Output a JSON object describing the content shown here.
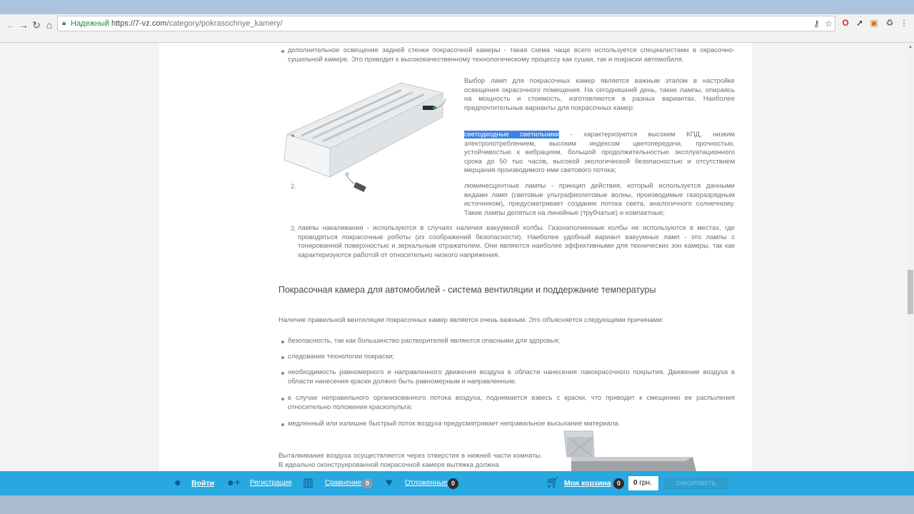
{
  "browser": {
    "security_label": "Надежный",
    "url_host": "https://7-vz.com",
    "url_path": "/category/pokrasochnye_kamery/"
  },
  "article": {
    "bullet_top": "дополнительное освещение задней стенки покрасочной камеры - такая схема чаще всего используется специалистами в окрасочно-сушильной камере. Это приводит к высококачественному технологическому процессу как сушки, так и покраски автомобиля.",
    "lamp_intro": " Выбор ламп для покрасочных камер является важным этапом в настройке освещения окрасочного помещения. На сегодняшний день, такие лампы, опираясь на мощность и стоимость, изготовляются в разных вариантах.  Наиболее предпочтительные варианты для покрасочных камер:",
    "item1_highlight": "светодиодные светильники",
    "item1_rest": " - характеризуются высоким КПД, низким электропотреблением, высоким индексом цветопередачи, прочностью, устойчивостью к вибрациям, большой продолжительностью эксплуатационного срока до 50 тыс  часов, высокой экологической безопасностью и отсутствием мерцания производимого ими светового потока;",
    "item2_num": "2.",
    "item2": "люминесцентные лампы - принцип действия, который используется данными видами ламп (световые ультрафиолетовые волны, производимые газоразрядным источником), предусматривает создание потока света, аналогичного солнечному. Такие лампы деляться на линейные (трубчатые) и компактные;",
    "item3_num": "3.",
    "item3": "лампы накаливания - используются в случаях наличия вакуумной колбы. Газонаполненные колбы не используются в местах, где проводяться покрасочные роботы  (из соображений безопасности). Наиболее удобный вариант вакуумных ламп - это лампы с тонированной поверхностью и зеркальным отражателем. Они являются наиболее эффективными для технических зон камеры, так как характеризуются работой от относительно низкого напряжения.",
    "heading": "Покрасочная камера для автомобилей - система вентиляции и поддержание температуры",
    "ventilation_intro": "Наличие правильной вентиляции покрасочных камер является очень важным. Это объясняется следующими причинами:",
    "reasons": [
      "безопасность, так как большинство растворителей являются опасными для здоровья;",
      "следование технологии покраски;",
      "необходимость равномерного и направленного движения воздуха в области нанесения лакокрасочного покрытия. Движение воздуха в области нанесения краски должно быть равномерным и направленным.",
      "в случае неправильного организованного потока воздуха, поднимается взвесь с краски, что приводит к смещению ее распыления относительно положения краскопульта;",
      "медленный или излишне быстрый поток воздуха предусматривает неправильное высыхание материала."
    ],
    "exhaust": "Выталкивание воздуха осуществляется через отверстия в нижней части комнаты. В идеально сконструированной покрасочной камере вытяжка должна"
  },
  "bottombar": {
    "login": "Войти",
    "register": "Регистрация",
    "compare": "Сравнение",
    "compare_count": "0",
    "deferred": "Отложенные",
    "deferred_count": "0",
    "cart": "Моя корзина",
    "cart_count": "0",
    "amount_value": "0",
    "amount_currency": " грн.",
    "order": "ОФОРМИТЬ"
  },
  "colors": {
    "bar": "#27a8e0",
    "badge_gray": "#8a9aa6",
    "badge_dark": "#2b2b2b",
    "highlight": "#3c84e0"
  }
}
